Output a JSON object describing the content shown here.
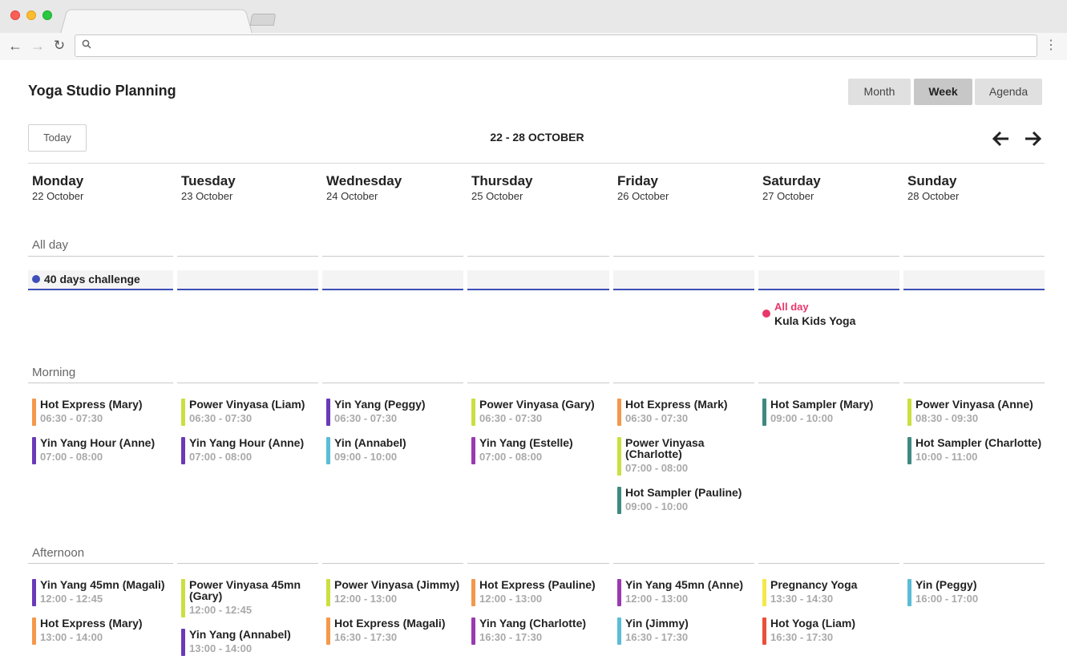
{
  "app": {
    "title": "Yoga Studio Planning",
    "views": {
      "month": "Month",
      "week": "Week",
      "agenda": "Agenda",
      "selected": "Week"
    },
    "today_label": "Today",
    "range_label": "22 - 28 OCTOBER"
  },
  "days": [
    {
      "name": "Monday",
      "date": "22 October"
    },
    {
      "name": "Tuesday",
      "date": "23 October"
    },
    {
      "name": "Wednesday",
      "date": "24 October"
    },
    {
      "name": "Thursday",
      "date": "25 October"
    },
    {
      "name": "Friday",
      "date": "26 October"
    },
    {
      "name": "Saturday",
      "date": "27 October"
    },
    {
      "name": "Sunday",
      "date": "28 October"
    }
  ],
  "sections": {
    "allday": "All day",
    "morning": "Morning",
    "afternoon": "Afternoon"
  },
  "allday_events": {
    "challenge": {
      "title": "40 days challenge",
      "color": "#3e4fb8"
    },
    "kula": {
      "when": "All day",
      "title": "Kula Kids Yoga",
      "color": "#e8376a"
    }
  },
  "colors": {
    "orange": "#f4984a",
    "purple": "#6a3ab8",
    "lime": "#cbdf3f",
    "teal": "#3e8a80",
    "cyan": "#5bbcd6",
    "magenta": "#9a3ab0",
    "yellow": "#f4e84a",
    "red": "#e8503a"
  },
  "morning": [
    [
      {
        "title": "Hot Express (Mary)",
        "time": "06:30 - 07:30",
        "color": "#f4984a"
      },
      {
        "title": "Yin Yang Hour (Anne)",
        "time": "07:00 - 08:00",
        "color": "#6a3ab8"
      }
    ],
    [
      {
        "title": "Power Vinyasa (Liam)",
        "time": "06:30 - 07:30",
        "color": "#cbdf3f"
      },
      {
        "title": "Yin Yang Hour (Anne)",
        "time": "07:00 - 08:00",
        "color": "#6a3ab8"
      }
    ],
    [
      {
        "title": "Yin Yang (Peggy)",
        "time": "06:30 - 07:30",
        "color": "#6a3ab8"
      },
      {
        "title": "Yin (Annabel)",
        "time": "09:00 - 10:00",
        "color": "#5bbcd6"
      }
    ],
    [
      {
        "title": "Power Vinyasa (Gary)",
        "time": "06:30 - 07:30",
        "color": "#cbdf3f"
      },
      {
        "title": "Yin Yang (Estelle)",
        "time": "07:00 - 08:00",
        "color": "#9a3ab0"
      }
    ],
    [
      {
        "title": "Hot Express (Mark)",
        "time": "06:30 - 07:30",
        "color": "#f4984a"
      },
      {
        "title": "Power Vinyasa (Charlotte)",
        "time": "07:00 - 08:00",
        "color": "#cbdf3f"
      },
      {
        "title": "Hot Sampler (Pauline)",
        "time": "09:00 - 10:00",
        "color": "#3e8a80"
      }
    ],
    [
      {
        "title": "Hot Sampler (Mary)",
        "time": "09:00 - 10:00",
        "color": "#3e8a80"
      }
    ],
    [
      {
        "title": "Power Vinyasa (Anne)",
        "time": "08:30 - 09:30",
        "color": "#cbdf3f"
      },
      {
        "title": "Hot Sampler (Charlotte)",
        "time": "10:00 - 11:00",
        "color": "#3e8a80"
      }
    ]
  ],
  "afternoon": [
    [
      {
        "title": "Yin Yang 45mn (Magali)",
        "time": "12:00 - 12:45",
        "color": "#6a3ab8"
      },
      {
        "title": "Hot Express (Mary)",
        "time": "13:00 - 14:00",
        "color": "#f4984a"
      }
    ],
    [
      {
        "title": "Power Vinyasa 45mn (Gary)",
        "time": "12:00 - 12:45",
        "color": "#cbdf3f"
      },
      {
        "title": "Yin Yang (Annabel)",
        "time": "13:00 - 14:00",
        "color": "#6a3ab8"
      }
    ],
    [
      {
        "title": "Power Vinyasa (Jimmy)",
        "time": "12:00 - 13:00",
        "color": "#cbdf3f"
      },
      {
        "title": "Hot Express (Magali)",
        "time": "16:30 - 17:30",
        "color": "#f4984a"
      }
    ],
    [
      {
        "title": "Hot Express (Pauline)",
        "time": "12:00 - 13:00",
        "color": "#f4984a"
      },
      {
        "title": "Yin Yang (Charlotte)",
        "time": "16:30 - 17:30",
        "color": "#9a3ab0"
      }
    ],
    [
      {
        "title": "Yin Yang 45mn (Anne)",
        "time": "12:00 - 13:00",
        "color": "#9a3ab0"
      },
      {
        "title": "Yin (Jimmy)",
        "time": "16:30 - 17:30",
        "color": "#5bbcd6"
      }
    ],
    [
      {
        "title": "Pregnancy Yoga",
        "time": "13:30 - 14:30",
        "color": "#f4e84a"
      },
      {
        "title": "Hot Yoga (Liam)",
        "time": "16:30 - 17:30",
        "color": "#e8503a"
      }
    ],
    [
      {
        "title": "Yin (Peggy)",
        "time": "16:00 - 17:00",
        "color": "#5bbcd6"
      }
    ]
  ]
}
